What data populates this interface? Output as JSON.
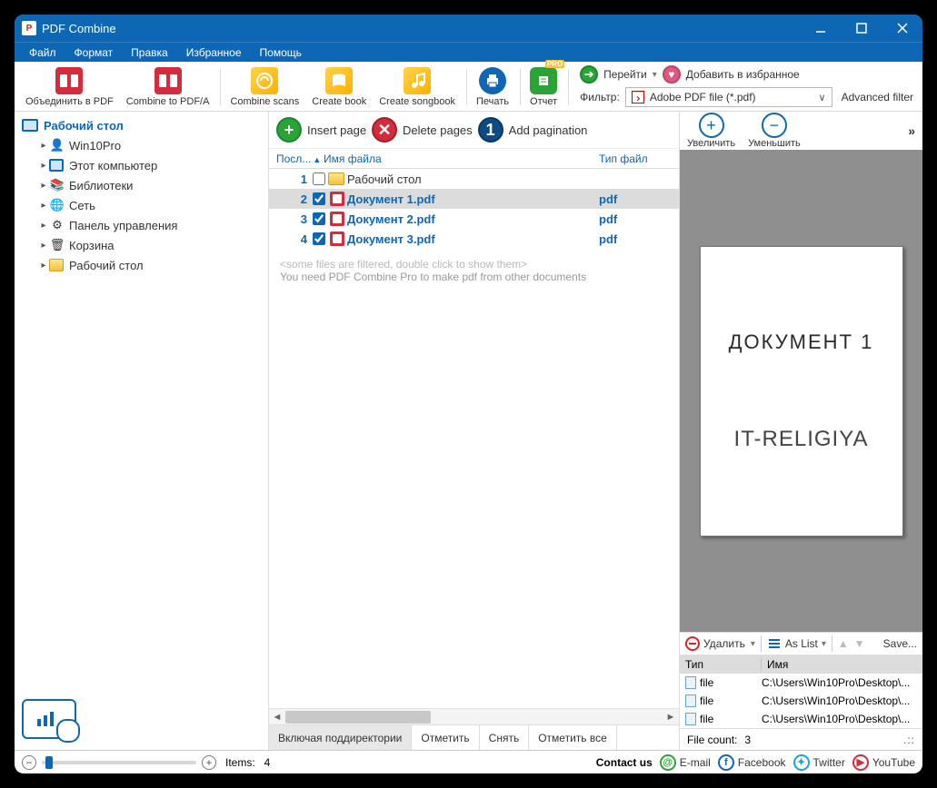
{
  "title": "PDF Combine",
  "menu": [
    "Файл",
    "Формат",
    "Правка",
    "Избранное",
    "Помощь"
  ],
  "toolbar": {
    "combine_pdf": "Объединить в PDF",
    "combine_pdfa": "Combine to PDF/A",
    "combine_scans": "Combine scans",
    "create_book": "Create book",
    "create_songbook": "Create songbook",
    "print": "Печать",
    "report": "Отчет",
    "pro": "PRO",
    "go": "Перейти",
    "fav": "Добавить в избранное",
    "filter_label": "Фильтр:",
    "filter_value": "Adobe PDF file (*.pdf)",
    "advanced": "Advanced filter"
  },
  "tree": {
    "root": "Рабочий стол",
    "items": [
      {
        "label": "Win10Pro",
        "icon": "user"
      },
      {
        "label": "Этот компьютер",
        "icon": "monitor"
      },
      {
        "label": "Библиотеки",
        "icon": "libraries"
      },
      {
        "label": "Сеть",
        "icon": "network"
      },
      {
        "label": "Панель управления",
        "icon": "control"
      },
      {
        "label": "Корзина",
        "icon": "trash"
      },
      {
        "label": "Рабочий стол",
        "icon": "folder"
      }
    ]
  },
  "center_toolbar": {
    "insert": "Insert page",
    "delete": "Delete pages",
    "paginate": "Add pagination"
  },
  "list_header": {
    "col1": "Посл...",
    "col2": "Имя файла",
    "col3": "Тип файл"
  },
  "files": [
    {
      "n": 1,
      "checked": false,
      "icon": "folder",
      "name": "Рабочий стол",
      "type": "",
      "sel": false,
      "bold": false
    },
    {
      "n": 2,
      "checked": true,
      "icon": "pdf",
      "name": "Документ 1.pdf",
      "type": "pdf",
      "sel": true,
      "bold": true
    },
    {
      "n": 3,
      "checked": true,
      "icon": "pdf",
      "name": "Документ 2.pdf",
      "type": "pdf",
      "sel": false,
      "bold": true
    },
    {
      "n": 4,
      "checked": true,
      "icon": "pdf",
      "name": "Документ 3.pdf",
      "type": "pdf",
      "sel": false,
      "bold": true
    }
  ],
  "hints": {
    "l1": "<some files are filtered, double click to show them>",
    "l2": "You need PDF Combine Pro to make pdf from other documents"
  },
  "center_tabs": {
    "t1": "Включая поддиректории",
    "t2": "Отметить",
    "t3": "Снять",
    "t4": "Отметить все"
  },
  "zoom": {
    "in": "Увеличить",
    "out": "Уменьшить"
  },
  "preview": {
    "title": "ДОКУМЕНТ 1",
    "sub": "IT-RELIGIYA"
  },
  "right_tb": {
    "delete": "Удалить",
    "aslist": "As List",
    "save": "Save..."
  },
  "right_list": {
    "h1": "Тип",
    "h2": "Имя",
    "rows": [
      {
        "type": "file",
        "name": "C:\\Users\\Win10Pro\\Desktop\\..."
      },
      {
        "type": "file",
        "name": "C:\\Users\\Win10Pro\\Desktop\\..."
      },
      {
        "type": "file",
        "name": "C:\\Users\\Win10Pro\\Desktop\\..."
      }
    ]
  },
  "file_count_label": "File count:",
  "file_count": "3",
  "status": {
    "items_label": "Items:",
    "items": "4",
    "contact": "Contact us",
    "email": "E-mail",
    "facebook": "Facebook",
    "twitter": "Twitter",
    "youtube": "YouTube"
  }
}
